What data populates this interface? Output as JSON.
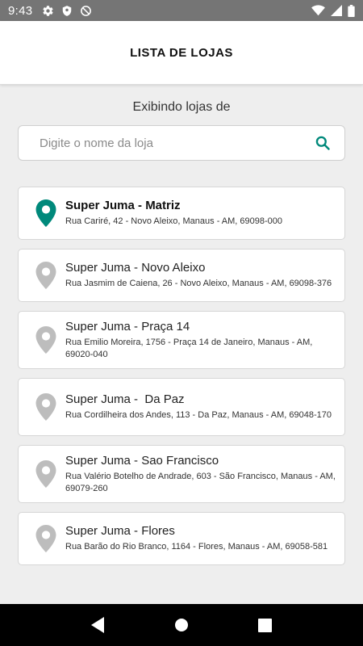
{
  "status_bar": {
    "time": "9:43",
    "left_icons": [
      "gear-icon",
      "shield-icon",
      "blocked-icon"
    ],
    "right_icons": [
      "wifi-icon",
      "signal-icon",
      "battery-icon"
    ]
  },
  "header": {
    "title": "LISTA DE LOJAS"
  },
  "subtitle": "Exibindo lojas de",
  "search": {
    "placeholder": "Digite o nome da loja",
    "value": ""
  },
  "colors": {
    "accent": "#00897b",
    "inactive_pin": "#bdbdbd"
  },
  "stores": [
    {
      "name": "Super Juma - Matriz",
      "address": "Rua Cariré, 42 - Novo Aleixo, Manaus - AM, 69098-000",
      "selected": true
    },
    {
      "name": "Super Juma - Novo Aleixo",
      "address": "Rua Jasmim de Caiena, 26 - Novo Aleixo, Manaus - AM, 69098-376",
      "selected": false
    },
    {
      "name": "Super Juma - Praça 14",
      "address": "Rua Emilio Moreira, 1756 - Praça 14 de Janeiro, Manaus - AM, 69020-040",
      "selected": false
    },
    {
      "name": "Super Juma -  Da Paz",
      "address": "Rua Cordilheira dos Andes, 113 - Da Paz, Manaus - AM, 69048-170",
      "selected": false
    },
    {
      "name": "Super Juma - Sao Francisco",
      "address": "Rua Valério Botelho de Andrade, 603 - São Francisco, Manaus - AM, 69079-260",
      "selected": false
    },
    {
      "name": "Super Juma - Flores",
      "address": "Rua Barão do Rio Branco, 1164 - Flores, Manaus - AM, 69058-581",
      "selected": false
    }
  ],
  "nav_bar": {
    "buttons": [
      "back-icon",
      "home-icon",
      "recents-icon"
    ]
  }
}
